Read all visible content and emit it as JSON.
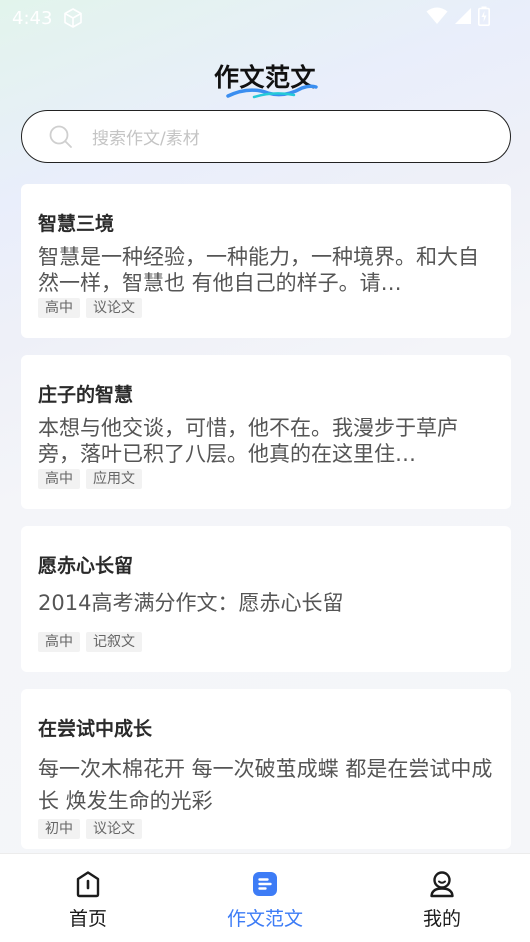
{
  "status_bar": {
    "time": "4:43"
  },
  "header": {
    "title": "作文范文"
  },
  "search": {
    "placeholder": "搜索作文/素材"
  },
  "articles": [
    {
      "title": "智慧三境",
      "excerpt": "智慧是一种经验，一种能力，一种境界。和大自然一样，智慧也 有他自己的样子。请…",
      "tags": [
        "高中",
        "议论文"
      ]
    },
    {
      "title": "庄子的智慧",
      "excerpt": "本想与他交谈，可惜，他不在。我漫步于草庐旁，落叶已积了八层。他真的在这里住…",
      "tags": [
        "高中",
        "应用文"
      ]
    },
    {
      "title": "愿赤心长留",
      "excerpt": "2014高考满分作文：愿赤心长留",
      "tags": [
        "高中",
        "记叙文"
      ]
    },
    {
      "title": "在尝试中成长",
      "excerpt": "每一次木棉花开  每一次破茧成蝶  都是在尝试中成长  焕发生命的光彩",
      "tags": [
        "初中",
        "议论文"
      ]
    }
  ],
  "bottom_nav": {
    "items": [
      {
        "label": "首页",
        "icon": "home-icon",
        "active": false
      },
      {
        "label": "作文范文",
        "icon": "essay-icon",
        "active": true
      },
      {
        "label": "我的",
        "icon": "profile-icon",
        "active": false
      }
    ],
    "active_color": "#3d7cf6"
  }
}
